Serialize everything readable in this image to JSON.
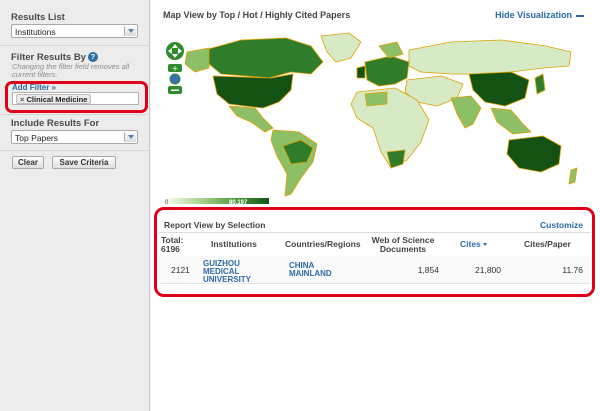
{
  "sidebar": {
    "results_list_label": "Results List",
    "results_list_value": "Institutions",
    "filter_label": "Filter Results By",
    "filter_note": "Changing the filter field removes all current filters.",
    "add_filter": "Add Filter »",
    "chip_label": "Clinical Medicine",
    "chip_remove": "×",
    "include_label": "Include Results For",
    "include_value": "Top Papers",
    "clear": "Clear",
    "save": "Save Criteria"
  },
  "map": {
    "title": "Map View by Top / Hot / Highly Cited Papers",
    "hide": "Hide Visualization",
    "legend_min": "0",
    "legend_max": "80,197",
    "colors": {
      "light": "#d6ebc5",
      "mid": "#8dbf67",
      "dark": "#2f7d2a",
      "darkest": "#145214",
      "border": "#e0a000"
    }
  },
  "report": {
    "title": "Report View by Selection",
    "customize": "Customize",
    "columns": {
      "total": "Total:",
      "total_count": "6196",
      "institutions": "Institutions",
      "countries": "Countries/Regions",
      "wos": "Web of Science Documents",
      "cites": "Cites",
      "cites_per_paper": "Cites/Paper"
    },
    "rows": [
      {
        "rank": "2121",
        "institution": "GUIZHOU MEDICAL UNIVERSITY",
        "country": "CHINA MAINLAND",
        "documents": "1,854",
        "cites": "21,800",
        "cites_per_paper": "11.76"
      }
    ]
  }
}
